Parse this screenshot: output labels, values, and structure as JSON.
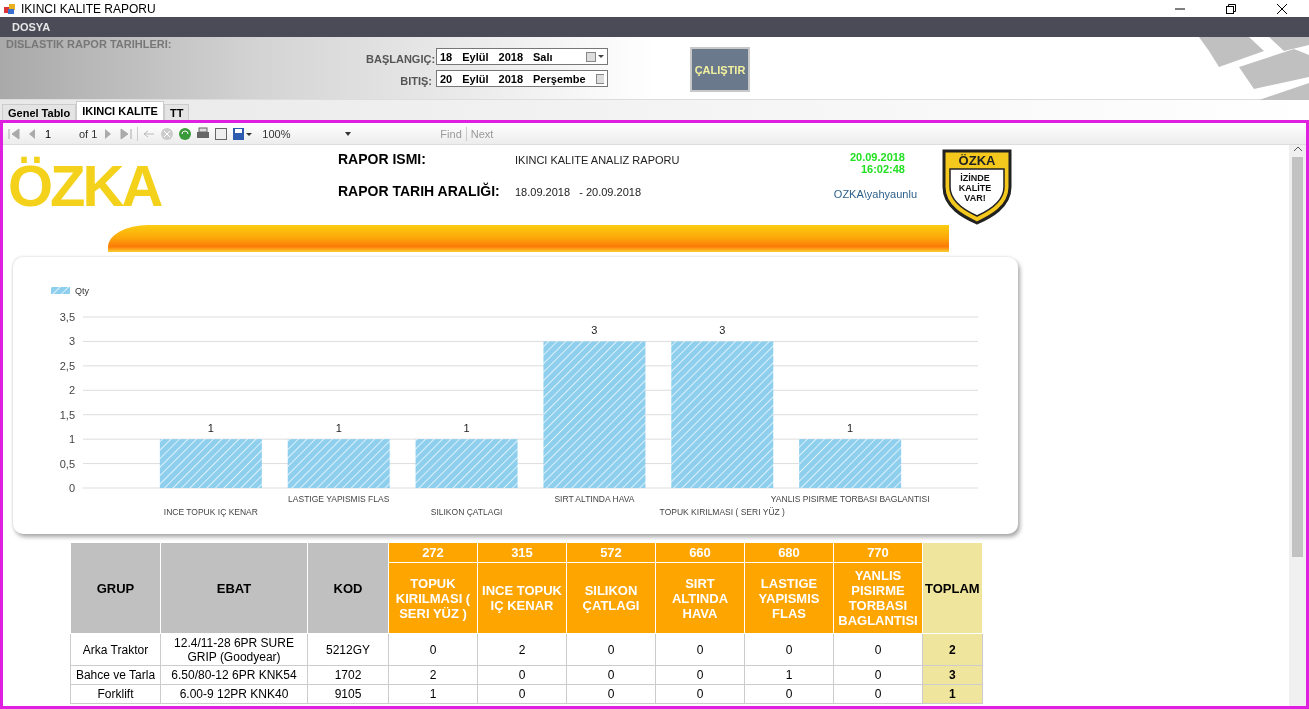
{
  "window": {
    "title": "IKINCI KALITE RAPORU"
  },
  "menu": [
    {
      "label": "DOSYA"
    }
  ],
  "header": {
    "title": "DISLASTIK RAPOR TARIHLERI:",
    "dates": [
      {
        "label": "BAŞLANGIÇ:",
        "day": "18",
        "month": "Eylül",
        "year": "2018",
        "weekday": "Salı"
      },
      {
        "label": "BITIŞ:",
        "day": "20",
        "month": "Eylül",
        "year": "2018",
        "weekday": "Perşembe"
      }
    ],
    "run_button": "ÇALIŞTIR"
  },
  "tabs": [
    {
      "label": "Genel Tablo",
      "selected": false
    },
    {
      "label": "IKINCI KALITE",
      "selected": true
    },
    {
      "label": "TT",
      "selected": false
    }
  ],
  "toolbar": {
    "page": "1",
    "of": "of 1",
    "zoom": "100%",
    "find": "Find",
    "next": "Next"
  },
  "report": {
    "logo": "ÖZKA",
    "name_label": "RAPOR ISMI:",
    "name": "IKINCI KALITE ANALIZ RAPORU",
    "range_label": "RAPOR TARIH ARALIĞI:",
    "range_start": "18.09.2018",
    "range_end": "- 20.09.2018",
    "date": "20.09.2018",
    "time": "16:02:48",
    "user": "OZKA\\yahyaunlu",
    "badge": {
      "brand": "ÖZKA",
      "lines": [
        "İZİNDE",
        "KALİTE",
        "VAR!"
      ]
    }
  },
  "chart": {
    "chart_data": {
      "type": "bar",
      "categories": [
        "INCE TOPUK IÇ KENAR",
        "LASTIGE YAPISMIS FLAS",
        "SILIKON ÇATLAGI",
        "SIRT ALTINDA HAVA",
        "TOPUK KIRILMASI ( SERI YÜZ )",
        "YANLIS PISIRME TORBASI BAGLANTISI"
      ],
      "series": [
        {
          "name": "Qty",
          "color": "#8ecfee",
          "values": [
            1,
            1,
            1,
            3,
            3,
            1
          ]
        }
      ],
      "ylim": [
        0,
        3.5
      ],
      "yticks": [
        0,
        {
          "value": 0.5,
          "label": "0,5"
        },
        1,
        {
          "value": 1.5,
          "label": "1,5"
        },
        2,
        {
          "value": 2.5,
          "label": "2,5"
        },
        3,
        {
          "value": 3.5,
          "label": "3,5"
        }
      ],
      "data_labels": true,
      "grid": true
    }
  },
  "table": {
    "columns": [
      {
        "kind": "info",
        "label": "GRUP"
      },
      {
        "kind": "info",
        "label": "EBAT"
      },
      {
        "kind": "info",
        "label": "KOD"
      },
      {
        "kind": "defect",
        "code": "272",
        "label": "TOPUK KIRILMASI ( SERI YÜZ )"
      },
      {
        "kind": "defect",
        "code": "315",
        "label": "INCE TOPUK IÇ KENAR"
      },
      {
        "kind": "defect",
        "code": "572",
        "label": "SILIKON ÇATLAGI"
      },
      {
        "kind": "defect",
        "code": "660",
        "label": "SIRT ALTINDA HAVA"
      },
      {
        "kind": "defect",
        "code": "680",
        "label": "LASTIGE YAPISMIS FLAS"
      },
      {
        "kind": "defect",
        "code": "770",
        "label": "YANLIS PISIRME TORBASI BAGLANTISI"
      },
      {
        "kind": "total",
        "label": "TOPLAM"
      }
    ],
    "rows": [
      [
        "Arka Traktor",
        "12.4/11-28 6PR SURE GRIP (Goodyear)",
        "5212GY",
        "0",
        "2",
        "0",
        "0",
        "0",
        "0",
        "2"
      ],
      [
        "Bahce ve Tarla",
        "6.50/80-12 6PR KNK54",
        "1702",
        "2",
        "0",
        "0",
        "0",
        "1",
        "0",
        "3"
      ],
      [
        "Forklift",
        "6.00-9 12PR KNK40",
        "9105",
        "1",
        "0",
        "0",
        "0",
        "0",
        "0",
        "1"
      ]
    ]
  }
}
